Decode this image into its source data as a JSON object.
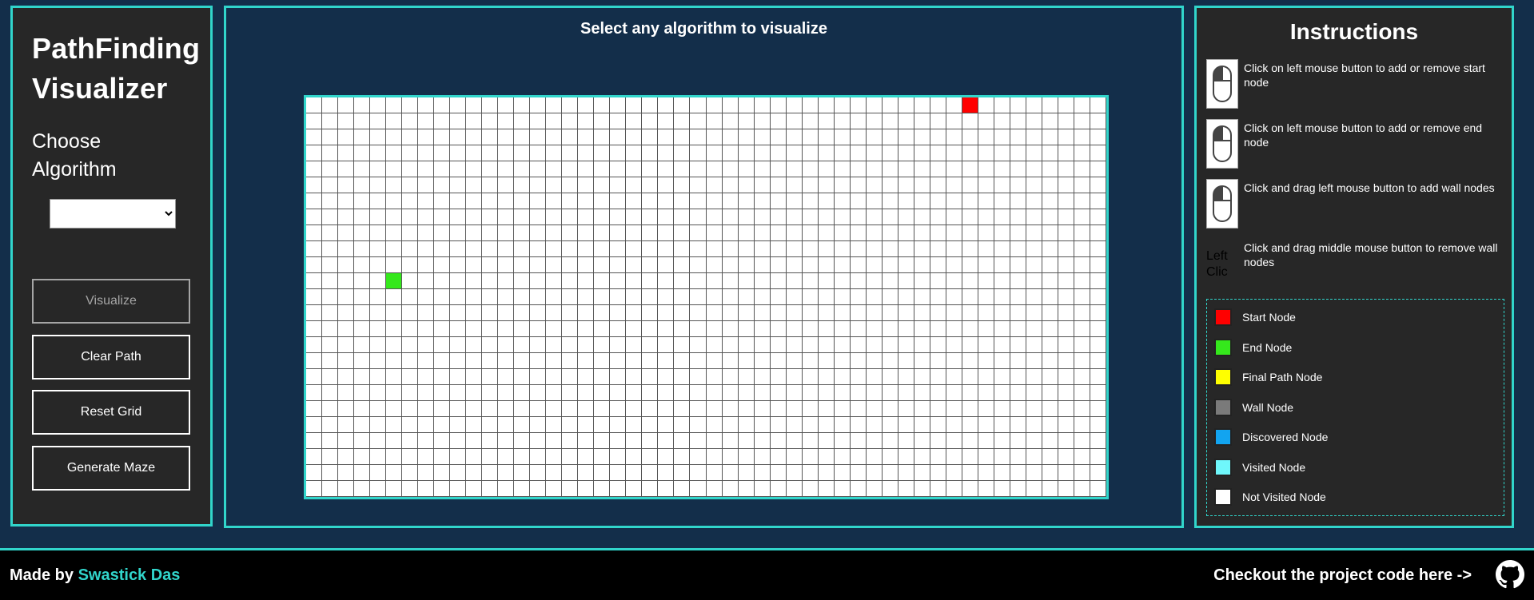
{
  "sidebar": {
    "title_line1": "PathFinding",
    "title_line2": "Visualizer",
    "choose_line1": "Choose",
    "choose_line2": "Algorithm",
    "algorithm_value": "",
    "buttons": {
      "visualize": "Visualize",
      "clear_path": "Clear Path",
      "reset_grid": "Reset Grid",
      "generate_maze": "Generate Maze"
    }
  },
  "main": {
    "headline": "Select any algorithm to visualize",
    "grid": {
      "columns": 50,
      "rows": 25,
      "start_node": {
        "row": 0,
        "col": 41
      },
      "end_node": {
        "row": 11,
        "col": 5
      }
    }
  },
  "instructions": {
    "title": "Instructions",
    "items": [
      {
        "icon": "left-click-mouse-icon",
        "text": "Click on left mouse button to add or remove start node"
      },
      {
        "icon": "left-click-mouse-icon",
        "text": "Click on left mouse button to add or remove end node"
      },
      {
        "icon": "left-click-mouse-icon",
        "text": "Click and drag left mouse button to add wall nodes"
      },
      {
        "icon": "broken-image-icon",
        "alt": "Left Clic",
        "text": "Click and drag middle mouse button to remove wall nodes"
      }
    ]
  },
  "legend": [
    {
      "label": "Start Node",
      "color": "#ff0000"
    },
    {
      "label": "End Node",
      "color": "#35e81c"
    },
    {
      "label": "Final Path Node",
      "color": "#ffff00"
    },
    {
      "label": "Wall Node",
      "color": "#7a7a7a"
    },
    {
      "label": "Discovered Node",
      "color": "#12a4f0"
    },
    {
      "label": "Visited Node",
      "color": "#6ff7fb"
    },
    {
      "label": "Not Visited Node",
      "color": "#ffffff"
    }
  ],
  "footer": {
    "made_by_prefix": "Made by ",
    "author": "Swastick Das",
    "checkout": "Checkout the project code here ->",
    "github_icon": "github-icon"
  }
}
